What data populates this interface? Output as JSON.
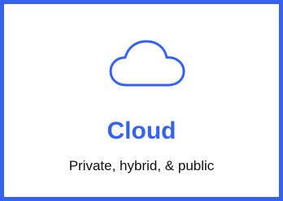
{
  "card": {
    "title": "Cloud",
    "subtitle": "Private, hybrid, & public",
    "icon": "cloud-icon"
  },
  "colors": {
    "accent": "#3662f0",
    "text": "#111111",
    "background": "#ffffff"
  }
}
